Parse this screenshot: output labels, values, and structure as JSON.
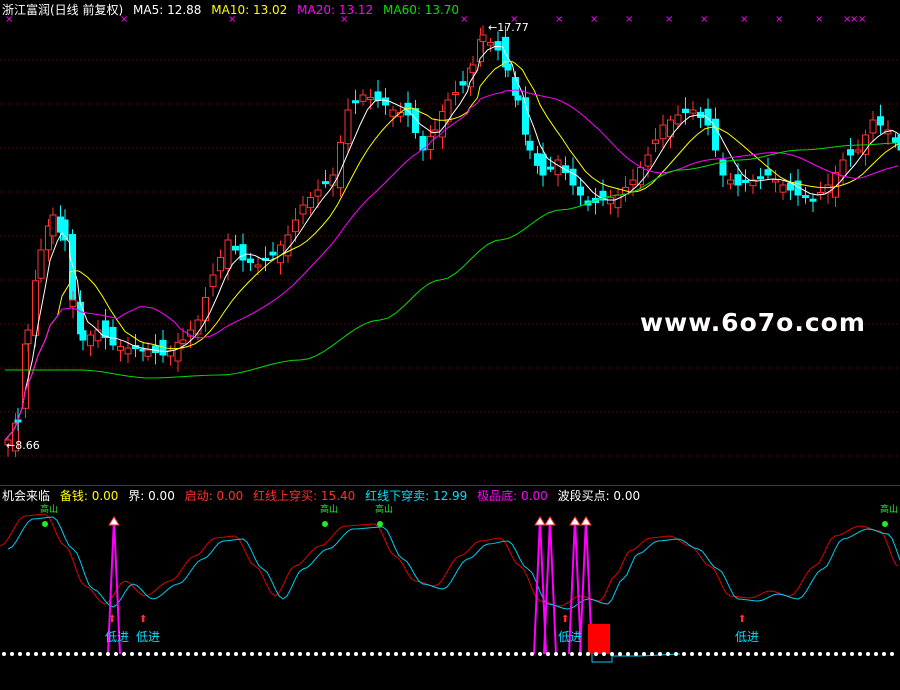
{
  "top_header": {
    "title": "浙江富润(日线 前复权)",
    "ma5": "MA5: 12.88",
    "ma10": "MA10: 13.02",
    "ma20": "MA20: 13.12",
    "ma60": "MA60: 13.70"
  },
  "price_labels": {
    "high": "17.77",
    "low": "8.66"
  },
  "watermark": "www.6o7o.com",
  "bottom_header": {
    "title": "机会来临",
    "beiqian": "备钱: 0.00",
    "jie": "界: 0.00",
    "qidong": "启动: 0.00",
    "hongxian_up": "红线上穿买: 15.40",
    "hongxian_down": "红线下穿卖: 12.99",
    "jipindi": "极品底: 0.00",
    "boduan": "波段买点: 0.00"
  },
  "indicator_labels": {
    "gaoshan": "高山",
    "dijin": "低进"
  },
  "colors": {
    "up": "#ff3232",
    "down": "#00ffff",
    "ma5": "#ffffff",
    "ma10": "#ffff00",
    "ma20": "#ff00ff",
    "ma60": "#00e000",
    "red_line": "#e00000",
    "cyan_line": "#00ccee",
    "magenta": "#ff00ff"
  }
}
